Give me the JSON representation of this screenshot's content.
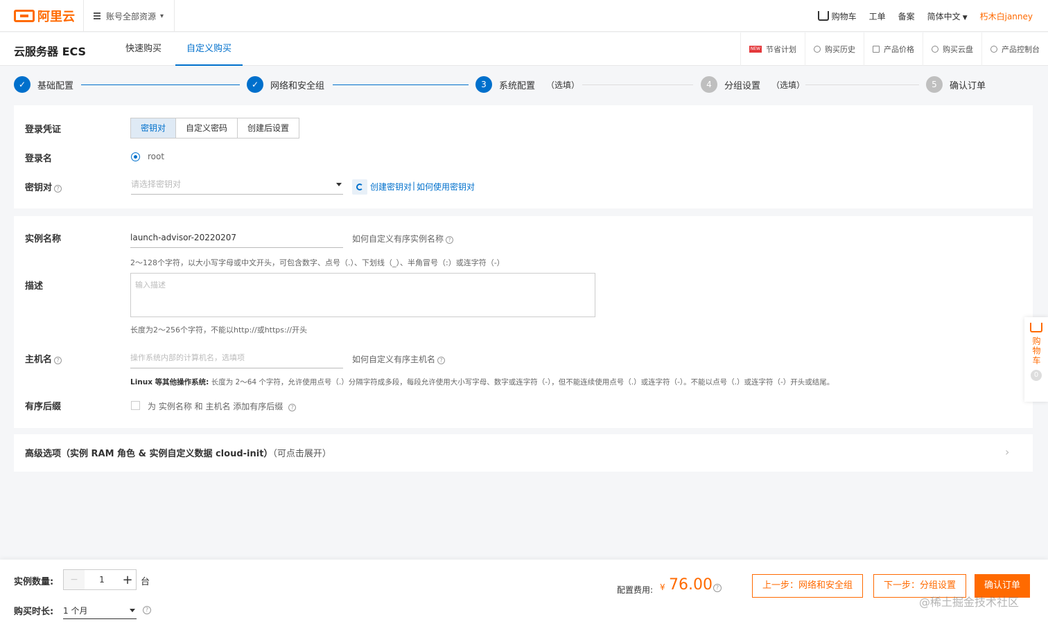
{
  "topbar": {
    "logo": "阿里云",
    "resource_selector": "账号全部资源",
    "nav": {
      "cart": "购物车",
      "ticket": "工单",
      "filing": "备案",
      "language": "简体中文",
      "user": "朽木白janney"
    }
  },
  "subheader": {
    "product_title": "云服务器 ECS",
    "tabs": [
      "快速购买",
      "自定义购买"
    ],
    "active_tab": "自定义购买",
    "shortcuts": [
      "节省计划",
      "购买历史",
      "产品价格",
      "购买云盘",
      "产品控制台"
    ],
    "new_badge": "NEW"
  },
  "steps": [
    {
      "label": "基础配置",
      "state": "done"
    },
    {
      "label": "网络和安全组",
      "state": "done"
    },
    {
      "number": "3",
      "label": "系统配置",
      "optional": "（选填）",
      "state": "current"
    },
    {
      "number": "4",
      "label": "分组设置",
      "optional": "（选填）",
      "state": "todo"
    },
    {
      "number": "5",
      "label": "确认订单",
      "state": "todo"
    }
  ],
  "login": {
    "credential_label": "登录凭证",
    "credential_options": [
      "密钥对",
      "自定义密码",
      "创建后设置"
    ],
    "selected_credential": "密钥对",
    "login_name_label": "登录名",
    "login_name_value": "root",
    "keypair_label": "密钥对",
    "keypair_placeholder": "请选择密钥对",
    "create_keypair_link": "创建密钥对",
    "separator": "|",
    "how_to_use_link": "如何使用密钥对"
  },
  "instance": {
    "name_label": "实例名称",
    "name_value": "launch-advisor-20220207",
    "name_help": "如何自定义有序实例名称",
    "name_hint": "2～128个字符，以大小写字母或中文开头，可包含数字、点号（.）、下划线（_）、半角冒号（:）或连字符（-）",
    "desc_label": "描述",
    "desc_placeholder": "输入描述",
    "desc_hint": "长度为2～256个字符，不能以http://或https://开头",
    "hostname_label": "主机名",
    "hostname_placeholder": "操作系统内部的计算机名，选填项",
    "hostname_help": "如何自定义有序主机名",
    "hostname_hint_bold": "Linux 等其他操作系统:",
    "hostname_hint": "长度为 2～64 个字符，允许使用点号（.）分隔字符成多段，每段允许使用大小写字母、数字或连字符（-），但不能连续使用点号（.）或连字符（-）。不能以点号（.）或连字符（-）开头或结尾。",
    "suffix_label": "有序后缀",
    "suffix_text": "为 实例名称 和 主机名 添加有序后缀"
  },
  "advanced": {
    "title": "高级选项（实例 RAM 角色 & 实例自定义数据 cloud-init）",
    "expand_hint": "（可点击展开）"
  },
  "float_cart": {
    "label": "购物车",
    "count": "0"
  },
  "bottom": {
    "quantity_label": "实例数量:",
    "quantity_value": "1",
    "unit": "台",
    "duration_label": "购买时长:",
    "duration_value": "1 个月",
    "price_label": "配置费用:",
    "currency": "¥",
    "price": "76.00",
    "prev_button": "上一步：网络和安全组",
    "next_button": "下一步：分组设置",
    "confirm_button": "确认订单",
    "watermark": "@稀土掘金技术社区"
  },
  "colors": {
    "accent": "#0070cc",
    "brand": "#ff6a00",
    "background": "#f5f6f8"
  }
}
